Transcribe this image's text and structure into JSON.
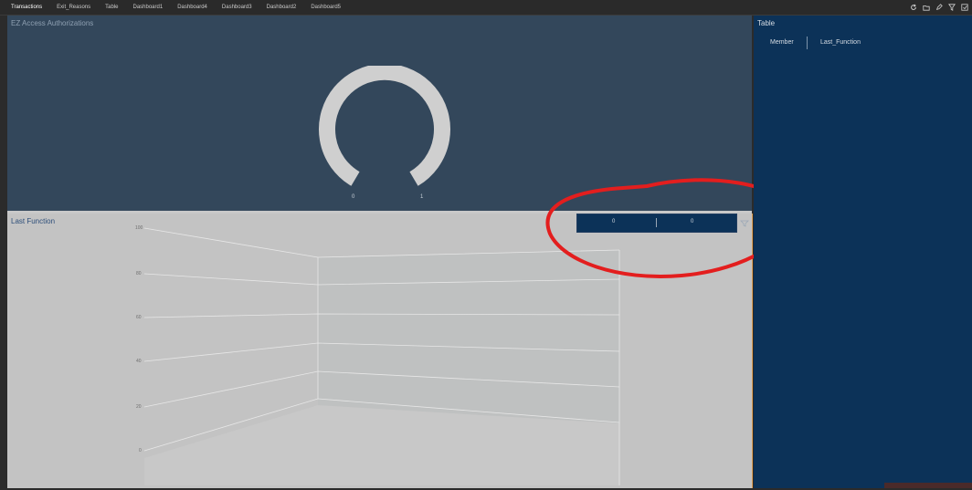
{
  "tabs": [
    {
      "label": "Transactions",
      "active": true
    },
    {
      "label": "Exit_Reasons"
    },
    {
      "label": "Table"
    },
    {
      "label": "Dashboard1"
    },
    {
      "label": "Dashboard4"
    },
    {
      "label": "Dashboard3"
    },
    {
      "label": "Dashboard2"
    },
    {
      "label": "Dashboard5"
    }
  ],
  "toolbar_icons": [
    "refresh-icon",
    "folder-icon",
    "pencil-icon",
    "filter-icon",
    "window-icon"
  ],
  "top_panel": {
    "title": "EZ Access Authorizations",
    "gauge": {
      "min_label": "0",
      "max_label": "1",
      "color": "#cfcfcf"
    }
  },
  "bottom_panel": {
    "title": "Last Function",
    "y_ticks": [
      "100",
      "80",
      "60",
      "40",
      "20",
      "0"
    ]
  },
  "slicer": {
    "left_value": "0",
    "right_value": "0"
  },
  "right_panel": {
    "title": "Table",
    "columns": [
      "Member",
      "Last_Function"
    ]
  },
  "colors": {
    "dark_panel": "#33475b",
    "navy_panel": "#0c3258",
    "light_panel": "#c3c3c3",
    "annotation_red": "#e31e1e"
  }
}
